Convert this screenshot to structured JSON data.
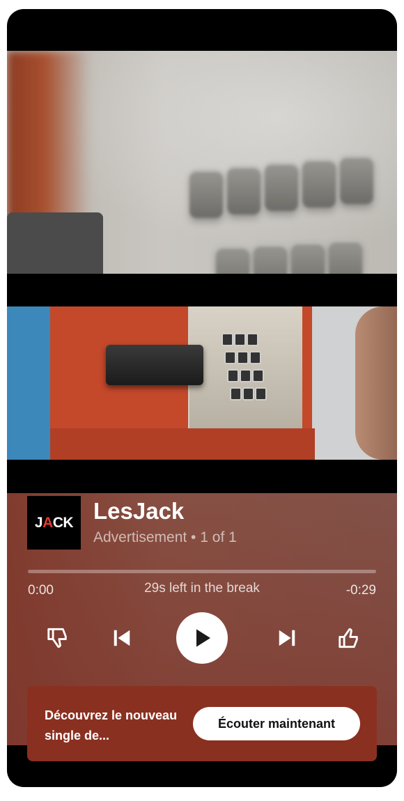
{
  "ad": {
    "logo_text_prefix": "J",
    "logo_text_accent": "A",
    "logo_text_suffix": "CK",
    "title": "LesJack",
    "subtitle": "Advertisement • 1 of 1"
  },
  "playback": {
    "elapsed": "0:00",
    "break_status": "29s left in the break",
    "remaining": "-0:29",
    "progress": 0.0
  },
  "controls": {
    "dislike_icon": "thumbs-down-icon",
    "previous_icon": "skip-previous-icon",
    "play_icon": "play-icon",
    "next_icon": "skip-next-icon",
    "like_icon": "thumbs-up-icon"
  },
  "cta": {
    "text": "Découvrez le nouveau single de...",
    "button_label": "Écouter maintenant"
  },
  "colors": {
    "cta_background": "#8a3020",
    "logo_accent": "#e03a2a"
  }
}
